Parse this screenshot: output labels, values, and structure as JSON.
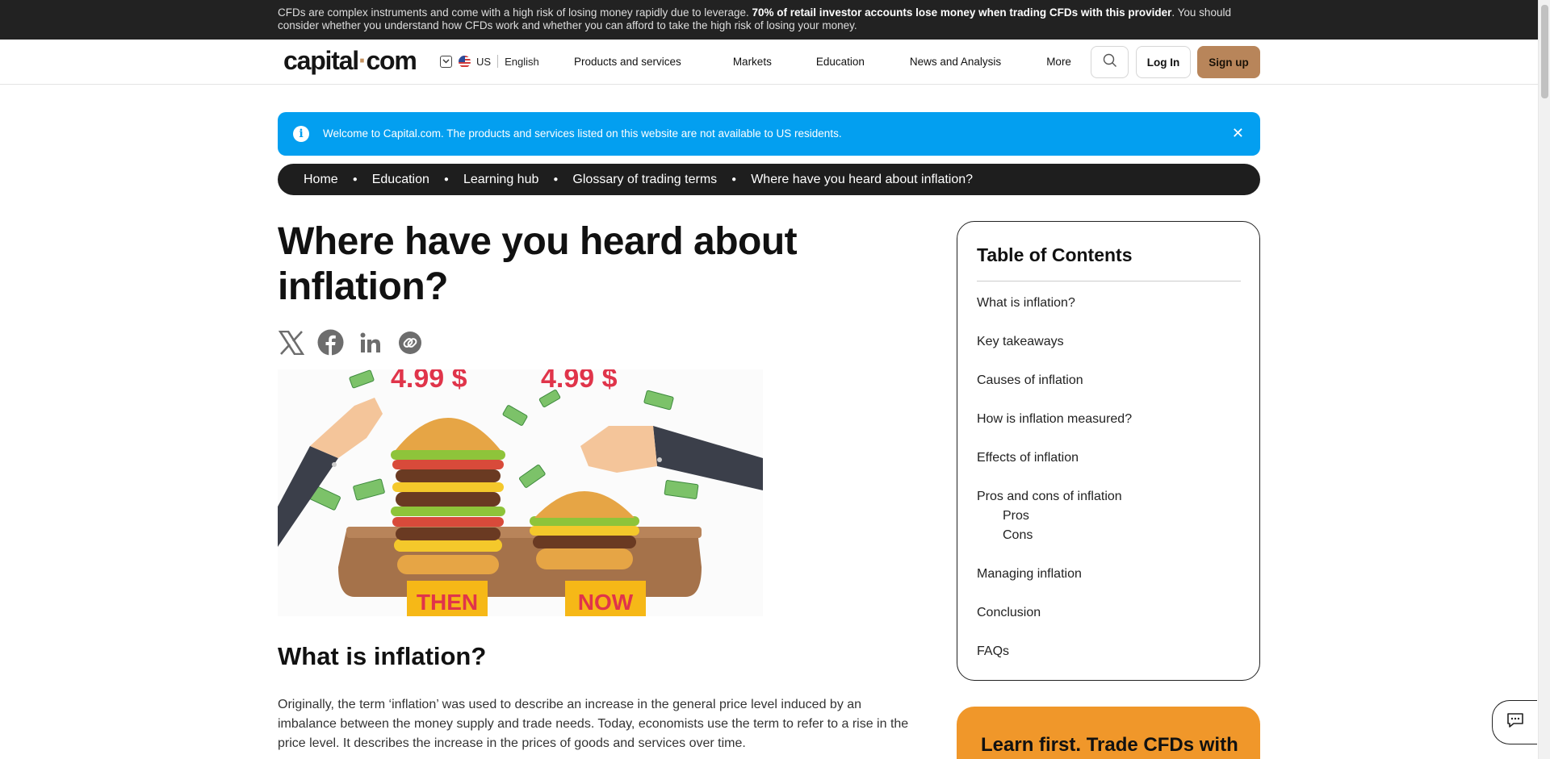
{
  "risk_warning": {
    "text_before": "CFDs are complex instruments and come with a high risk of losing money rapidly due to leverage. ",
    "bold": "70% of retail investor accounts lose money when trading CFDs with this provider",
    "text_after": ". You should consider whether you understand how CFDs work and whether you can afford to take the high risk of losing your money."
  },
  "header": {
    "logo_left": "capital",
    "logo_dot": "·",
    "logo_right": "com",
    "region": "US",
    "language": "English",
    "nav": [
      "Products and services",
      "Markets",
      "Education",
      "News and Analysis",
      "More"
    ],
    "login": "Log In",
    "signup": "Sign up"
  },
  "notice": {
    "icon": "info-icon",
    "text": "Welcome to Capital.com. The products and services listed on this website are not available to US residents."
  },
  "breadcrumb": [
    "Home",
    "Education",
    "Learning hub",
    "Glossary of trading terms",
    "Where have you heard about inflation?"
  ],
  "article": {
    "title": "Where have you heard about inflation?",
    "share_icons": [
      "x-icon",
      "facebook-icon",
      "linkedin-icon",
      "copy-link-icon"
    ],
    "hero": {
      "price_left": "4.99 $",
      "price_right": "4.99 $",
      "label_left": "THEN",
      "label_right": "NOW"
    },
    "section_title": "What is inflation?",
    "paragraph": "Originally, the term ‘inflation’ was used to describe an increase in the general price level induced by an imbalance between the money supply and trade needs. Today, economists use the term to refer to a rise in the price level. It describes the increase in the prices of goods and services over time."
  },
  "toc": {
    "title": "Table of Contents",
    "items": [
      "What is inflation?",
      "Key takeaways",
      "Causes of inflation",
      "How is inflation measured?",
      "Effects of inflation",
      "Pros and cons of inflation"
    ],
    "sub_items": [
      "Pros",
      "Cons"
    ],
    "items_after": [
      "Managing inflation",
      "Conclusion",
      "FAQs"
    ]
  },
  "promo": {
    "text": "Learn first. Trade CFDs with"
  },
  "colors": {
    "notice_blue": "#039ff0",
    "signup_bronze": "#b8855a",
    "promo_orange": "#f0972a",
    "price_red": "#e0344a"
  }
}
